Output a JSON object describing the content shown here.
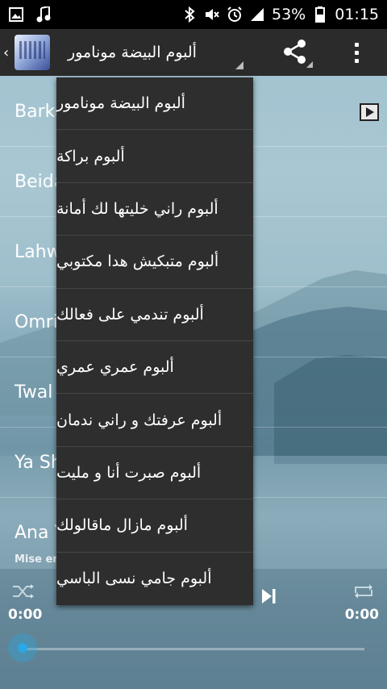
{
  "status_bar": {
    "battery": "53%",
    "time": "01:15",
    "icons": [
      "image-icon",
      "music-note-icon",
      "bluetooth-icon",
      "mute-icon",
      "alarm-icon",
      "signal-icon",
      "battery-icon"
    ]
  },
  "action_bar": {
    "selected_album": "ألبوم البيضة مونامور",
    "icons": [
      "app-logo",
      "share-icon",
      "overflow-menu-icon"
    ]
  },
  "songs": [
    {
      "title": "Barka"
    },
    {
      "title": "Beida"
    },
    {
      "title": "Lahw"
    },
    {
      "title": "Omri"
    },
    {
      "title": "Twal"
    },
    {
      "title": "Ya Sh"
    },
    {
      "title": "Ana Y"
    }
  ],
  "player": {
    "status_label": "Mise en",
    "elapsed": "0:00",
    "total": "0:00",
    "progress": 0
  },
  "dropdown": {
    "items": [
      "ألبوم البيضة مونامور",
      "ألبوم براكة",
      "ألبوم راني خليتها لك أمانة",
      "ألبوم متبكيش هدا مكتوبي",
      "ألبوم تندمي على فعالك",
      "ألبوم عمري عمري",
      "ألبوم عرفتك و راني ندمان",
      "ألبوم صبرت أنا و مليت",
      "ألبوم مازال ماقالولك",
      "ألبوم جامي نسى الباسي"
    ]
  },
  "colors": {
    "status_bar": "#000000",
    "action_bar": "#2b2b2b",
    "dropdown": "#2e2e2e",
    "accent": "#2aa8e6"
  }
}
